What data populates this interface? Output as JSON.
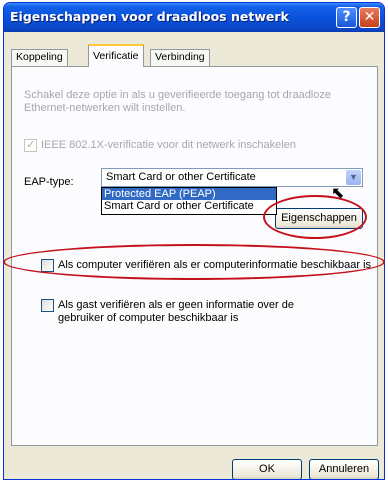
{
  "window": {
    "title": "Eigenschappen voor draadloos netwerk",
    "help_label": "?",
    "close_label": "✕"
  },
  "tabs": [
    {
      "label": "Koppeling",
      "active": false
    },
    {
      "label": "Verificatie",
      "active": true
    },
    {
      "label": "Verbinding",
      "active": false
    }
  ],
  "panel": {
    "description": "Schakel deze optie in als u geverifieerde toegang tot draadloze Ethernet-netwerken wilt instellen.",
    "ieee_checkbox": {
      "label": "IEEE 802.1X-verificatie voor dit netwerk inschakelen",
      "checked": true,
      "enabled": false
    },
    "eap_label": "EAP-type:",
    "eap_selected": "Smart Card or other Certificate",
    "eap_options": [
      "Protected EAP (PEAP)",
      "Smart Card or other Certificate"
    ],
    "properties_button": "Eigenschappen",
    "computer_checkbox": {
      "label": "Als computer verifiëren als er computerinformatie beschikbaar is",
      "checked": false
    },
    "guest_checkbox": {
      "label": "Als gast verifiëren als er geen informatie over de gebruiker of computer beschikbaar is",
      "checked": false
    }
  },
  "footer": {
    "ok_label": "OK",
    "cancel_label": "Annuleren"
  },
  "colors": {
    "annotation_ring": "#c4121d",
    "titlebar": "#0a52dc",
    "selection": "#316ac5"
  },
  "icons": [
    "help-icon",
    "close-icon",
    "dropdown-arrow-icon",
    "mouse-cursor-icon"
  ]
}
